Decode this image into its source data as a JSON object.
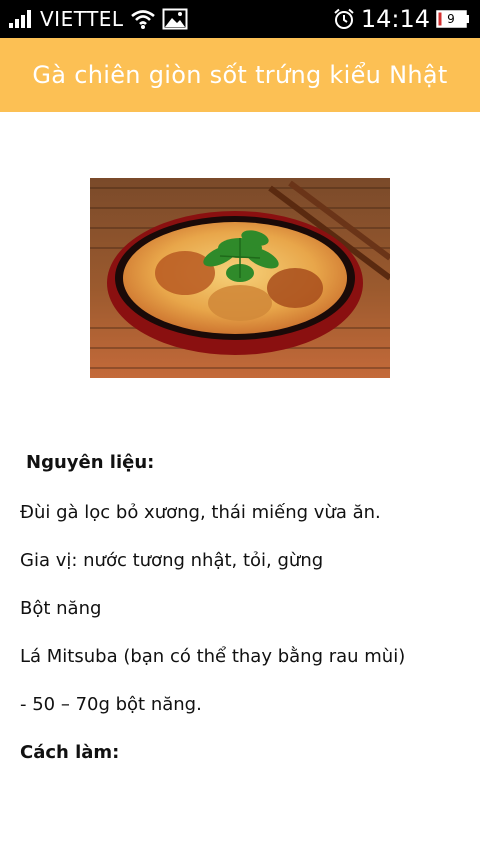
{
  "status_bar": {
    "carrier": "VIETTEL",
    "time": "14:14",
    "battery_level": "9",
    "icons": [
      "signal-icon",
      "wifi-icon",
      "gallery-icon",
      "alarm-icon",
      "battery-icon"
    ]
  },
  "app_bar": {
    "title": "Gà chiên giòn sốt trứng kiểu Nhật",
    "color": "#fcc054"
  },
  "article": {
    "image_name": "dish-photo",
    "ingredients_heading": "Nguyên liệu:",
    "lines": [
      "Đùi gà lọc bỏ xương, thái miếng vừa ăn.",
      "Gia vị: nước tương nhật, tỏi, gừng",
      "Bột năng",
      "Lá Mitsuba (bạn có thể thay bằng rau mùi)",
      "- 50 – 70g bột năng."
    ],
    "method_heading": "Cách làm:"
  }
}
